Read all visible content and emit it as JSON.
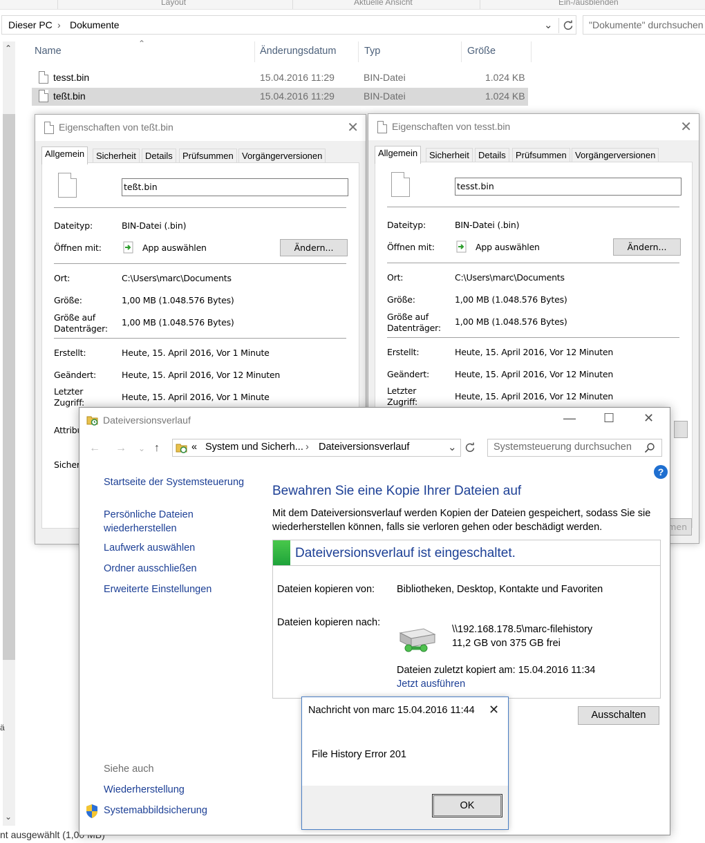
{
  "explorer": {
    "ribbon_groups": [
      "Layout",
      "Aktuelle Ansicht",
      "Ein-/ausblenden"
    ],
    "breadcrumb": [
      "Dieser PC",
      "Dokumente"
    ],
    "search_placeholder": "\"Dokumente\" durchsuchen",
    "columns": [
      "Name",
      "Änderungsdatum",
      "Typ",
      "Größe"
    ],
    "files": [
      {
        "name": "tesst.bin",
        "date": "15.04.2016 11:29",
        "type": "BIN-Datei",
        "size": "1.024 KB"
      },
      {
        "name": "teßt.bin",
        "date": "15.04.2016 11:29",
        "type": "BIN-Datei",
        "size": "1.024 KB"
      }
    ],
    "status_text": "nt ausgewählt (1,00 MB)",
    "side_char": "ä"
  },
  "props_left": {
    "title": "Eigenschaften von teßt.bin",
    "tabs": [
      "Allgemein",
      "Sicherheit",
      "Details",
      "Prüfsummen",
      "Vorgängerversionen"
    ],
    "filename": "teßt.bin",
    "labels": {
      "filetype": "Dateityp:",
      "openwith": "Öffnen mit:",
      "location": "Ort:",
      "size": "Größe:",
      "disksize": "Größe auf\nDatenträger:",
      "created": "Erstellt:",
      "modified": "Geändert:",
      "accessed": "Letzter\nZugriff:",
      "attributes": "Attribu",
      "security": "Sicher"
    },
    "filetype": "BIN-Datei (.bin)",
    "openwith": "App auswählen",
    "change_button": "Ändern...",
    "location": "C:\\Users\\marc\\Documents",
    "size": "1,00 MB (1.048.576 Bytes)",
    "disksize": "1,00 MB (1.048.576 Bytes)",
    "created": "Heute, 15. April 2016, Vor 1 Minute",
    "modified": "Heute, 15. April 2016, Vor 12 Minuten",
    "accessed": "Heute, 15. April 2016, Vor 1 Minute"
  },
  "props_right": {
    "title": "Eigenschaften von tesst.bin",
    "tabs": [
      "Allgemein",
      "Sicherheit",
      "Details",
      "Prüfsummen",
      "Vorgängerversionen"
    ],
    "filename": "tesst.bin",
    "labels": {
      "filetype": "Dateityp:",
      "openwith": "Öffnen mit:",
      "location": "Ort:",
      "size": "Größe:",
      "disksize": "Größe auf\nDatenträger:",
      "created": "Erstellt:",
      "modified": "Geändert:",
      "accessed": "Letzter\nZugriff:"
    },
    "filetype": "BIN-Datei (.bin)",
    "openwith": "App auswählen",
    "change_button": "Ändern...",
    "location": "C:\\Users\\marc\\Documents",
    "size": "1,00 MB (1.048.576 Bytes)",
    "disksize": "1,00 MB (1.048.576 Bytes)",
    "created": "Heute, 15. April 2016, Vor 12 Minuten",
    "modified": "Heute, 15. April 2016, Vor 12 Minuten",
    "accessed": "Heute, 15. April 2016, Vor 12 Minuten",
    "apply_fragment": "men"
  },
  "file_history": {
    "title": "Dateiversionsverlauf",
    "address_prefix": "«",
    "address_parts": [
      "System und Sicherh...",
      "Dateiversionsverlauf"
    ],
    "search_placeholder": "Systemsteuerung durchsuchen",
    "sidebar_links": [
      "Startseite der Systemsteuerung",
      "Persönliche Dateien\nwiederherstellen",
      "Laufwerk auswählen",
      "Ordner ausschließen",
      "Erweiterte Einstellungen"
    ],
    "see_also_heading": "Siehe auch",
    "see_also_links": [
      "Wiederherstellung",
      "Systemabbildsicherung"
    ],
    "heading": "Bewahren Sie eine Kopie Ihrer Dateien auf",
    "description": "Mit dem Dateiversionsverlauf werden Kopien der Dateien gespeichert, sodass Sie sie wiederherstellen können, falls sie verloren gehen oder beschädigt werden.",
    "status": "Dateiversionsverlauf ist eingeschaltet.",
    "copy_from_label": "Dateien kopieren von:",
    "copy_from_value": "Bibliotheken, Desktop, Kontakte und Favoriten",
    "copy_to_label": "Dateien kopieren nach:",
    "drive_path": "\\\\192.168.178.5\\marc-filehistory",
    "drive_space": "11,2 GB von 375 GB frei",
    "last_copied": "Dateien zuletzt kopiert am: 15.04.2016 11:34",
    "run_now": "Jetzt ausführen",
    "turn_off_button": "Ausschalten",
    "accent_color": "#1c3f95"
  },
  "message_box": {
    "title": "Nachricht von marc 15.04.2016 11:44",
    "text": "File History Error 201",
    "ok": "OK"
  }
}
